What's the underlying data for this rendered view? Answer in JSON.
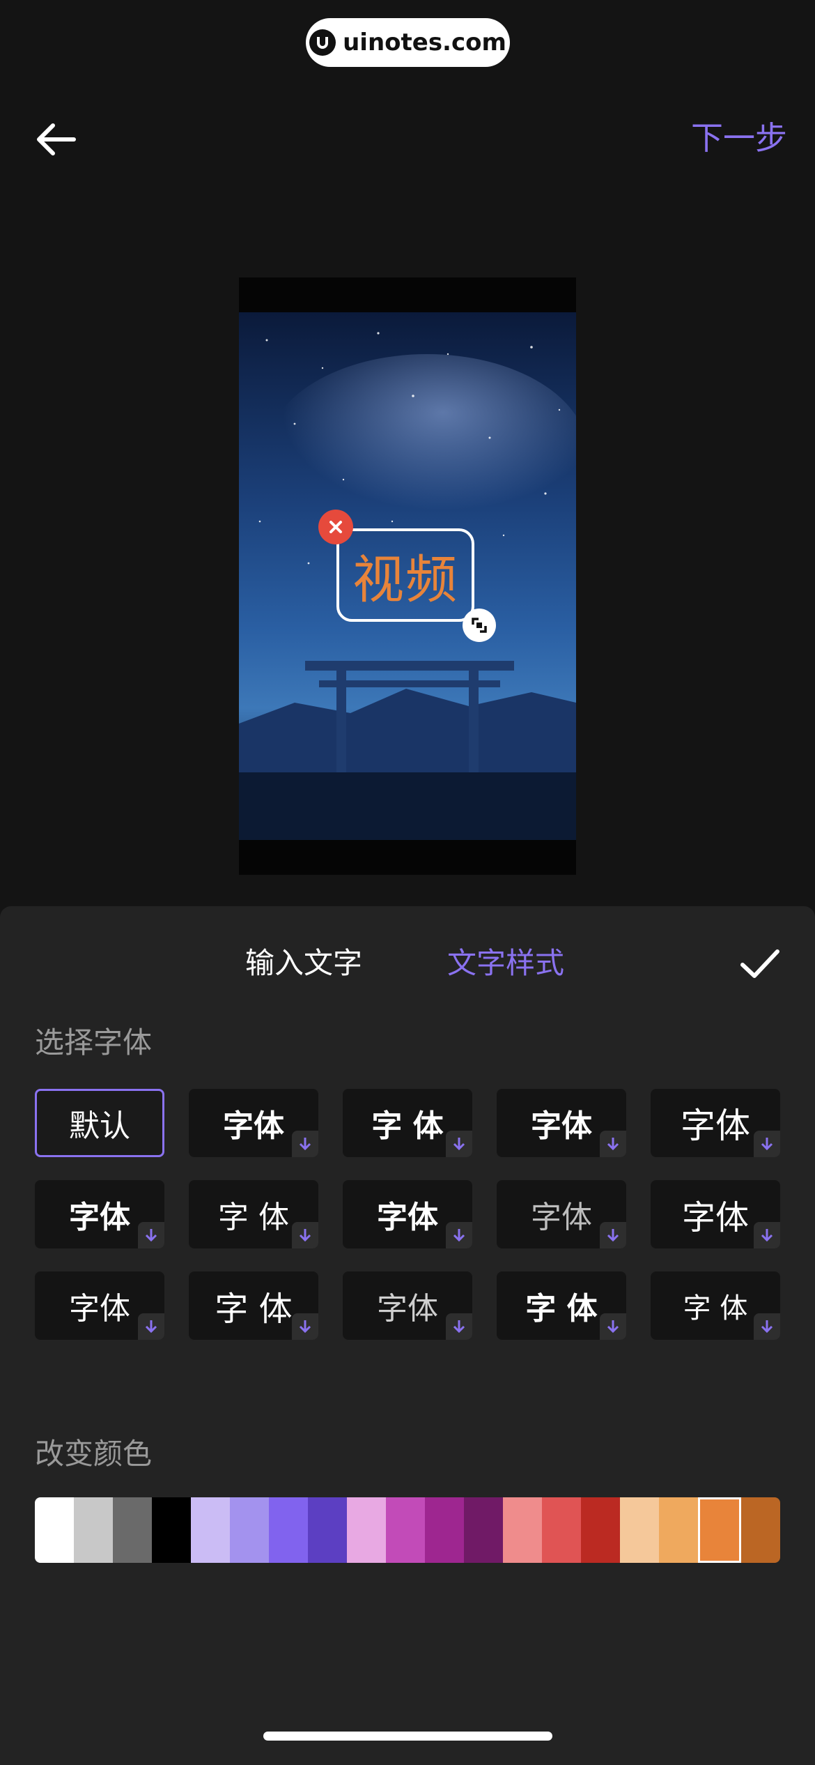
{
  "watermark": {
    "text": "uinotes.com",
    "icon": "uinotes-logo-icon"
  },
  "header": {
    "back_icon": "arrow-left-icon",
    "next_label": "下一步"
  },
  "preview": {
    "overlay_text": "视频",
    "text_color": "#e8843a",
    "delete_icon": "close-icon",
    "resize_icon": "resize-icon"
  },
  "tabs": [
    {
      "label": "输入文字",
      "active": false
    },
    {
      "label": "文字样式",
      "active": true
    }
  ],
  "confirm_icon": "checkmark-icon",
  "font_section": {
    "title": "选择字体",
    "fonts": [
      {
        "label": "默认",
        "selected": true,
        "downloadable": false
      },
      {
        "label": "字体",
        "selected": false,
        "downloadable": true
      },
      {
        "label": "字 体",
        "selected": false,
        "downloadable": true
      },
      {
        "label": "字体",
        "selected": false,
        "downloadable": true
      },
      {
        "label": "字体",
        "selected": false,
        "downloadable": true
      },
      {
        "label": "字体",
        "selected": false,
        "downloadable": true
      },
      {
        "label": "字 体",
        "selected": false,
        "downloadable": true
      },
      {
        "label": "字体",
        "selected": false,
        "downloadable": true
      },
      {
        "label": "字体",
        "selected": false,
        "downloadable": true
      },
      {
        "label": "字体",
        "selected": false,
        "downloadable": true
      },
      {
        "label": "字体",
        "selected": false,
        "downloadable": true
      },
      {
        "label": "字 体",
        "selected": false,
        "downloadable": true
      },
      {
        "label": "字体",
        "selected": false,
        "downloadable": true
      },
      {
        "label": "字 体",
        "selected": false,
        "downloadable": true
      },
      {
        "label": "字 体",
        "selected": false,
        "downloadable": true
      }
    ]
  },
  "color_section": {
    "title": "改变颜色",
    "colors": [
      "#ffffff",
      "#c8c8c8",
      "#6a6a6a",
      "#000000",
      "#cbbcf5",
      "#a392ee",
      "#8163ee",
      "#5c3fc2",
      "#e8a9e3",
      "#c24bb8",
      "#9e2690",
      "#701a66",
      "#ef8c8c",
      "#e05454",
      "#bb2a22",
      "#f5c89a",
      "#efa95e",
      "#e8843a",
      "#bb6624"
    ],
    "selected_index": 17
  },
  "colors": {
    "accent": "#8a72f0",
    "panel_bg": "#232323",
    "page_bg": "#141414"
  }
}
